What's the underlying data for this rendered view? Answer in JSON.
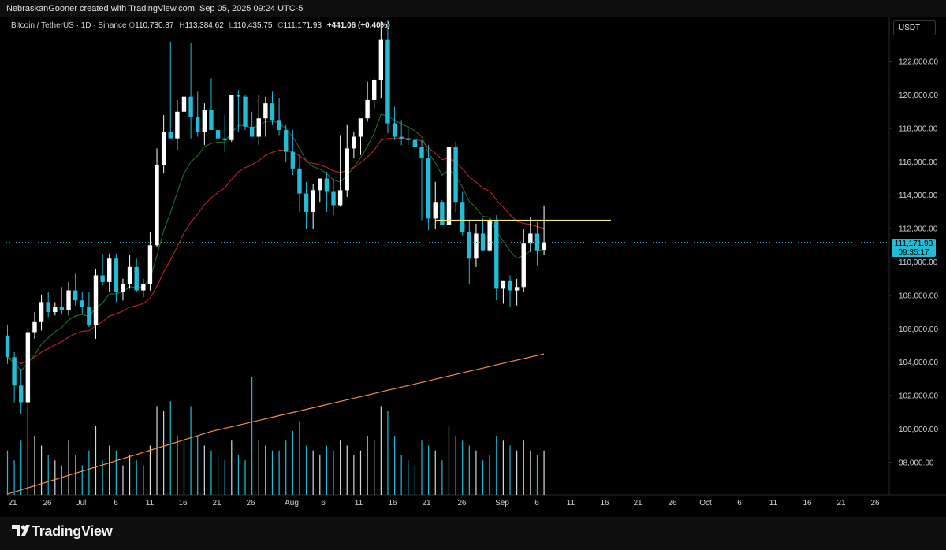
{
  "header": {
    "attribution": "NebraskanGooner created with TradingView.com, Sep 05, 2025 09:24 UTC-5"
  },
  "legend": {
    "symbol": "Bitcoin / TetherUS · 1D · Binance",
    "open_label": "O",
    "open": "110,730.87",
    "high_label": "H",
    "high": "113,384.62",
    "low_label": "L",
    "low": "110,435.75",
    "close_label": "C",
    "close": "111,171.93",
    "change": "+441.06 (+0.40%)"
  },
  "currency_button": "USDT",
  "price_tag": {
    "price": "111,171.93",
    "countdown": "09:35:17"
  },
  "branding": {
    "name": "TradingView"
  },
  "colors": {
    "up": "#ffffff",
    "down": "#22bcd6",
    "ema_fast": "#1f6e30",
    "ema_slow": "#b8262a",
    "ma_long": "#f28c4c",
    "hline": "#f5e28a"
  },
  "chart_data": {
    "type": "candlestick",
    "x_start": "2025-06-20",
    "x_end": "2025-09-05",
    "ylim": [
      96000,
      124000
    ],
    "yticks": [
      "122,000.00",
      "120,000.00",
      "118,000.00",
      "116,000.00",
      "114,000.00",
      "112,000.00",
      "110,000.00",
      "108,000.00",
      "106,000.00",
      "104,000.00",
      "102,000.00",
      "100,000.00",
      "98,000.00"
    ],
    "xticks": [
      "21",
      "26",
      "Jul",
      "6",
      "11",
      "16",
      "21",
      "26",
      "Aug",
      "6",
      "11",
      "16",
      "21",
      "26",
      "Sep",
      "6",
      "11",
      "16",
      "21",
      "26",
      "Oct",
      "6",
      "11",
      "16",
      "21",
      "26"
    ],
    "candles": [
      [
        105600,
        106200,
        103900,
        104300
      ],
      [
        104300,
        104600,
        101600,
        102600
      ],
      [
        102600,
        103600,
        100900,
        101600
      ],
      [
        101600,
        106000,
        101300,
        105800
      ],
      [
        105800,
        107000,
        105400,
        106400
      ],
      [
        106400,
        108000,
        105900,
        107600
      ],
      [
        107600,
        108200,
        106700,
        107000
      ],
      [
        107000,
        107600,
        106800,
        107300
      ],
      [
        107300,
        108500,
        106900,
        107100
      ],
      [
        107100,
        108800,
        106800,
        108300
      ],
      [
        108300,
        109300,
        107400,
        107700
      ],
      [
        107700,
        108200,
        106900,
        107300
      ],
      [
        107300,
        108200,
        106100,
        106200
      ],
      [
        106200,
        109600,
        105400,
        109200
      ],
      [
        109200,
        110500,
        108600,
        108800
      ],
      [
        108800,
        110500,
        108200,
        110200
      ],
      [
        110200,
        110500,
        107600,
        108200
      ],
      [
        108200,
        109000,
        107700,
        108700
      ],
      [
        108700,
        110400,
        108400,
        109700
      ],
      [
        109700,
        110200,
        108200,
        108300
      ],
      [
        108300,
        109000,
        107900,
        108700
      ],
      [
        108700,
        111800,
        108300,
        111000
      ],
      [
        111000,
        116800,
        110900,
        115800
      ],
      [
        115800,
        118800,
        115300,
        117800
      ],
      [
        117800,
        123200,
        117500,
        117400
      ],
      [
        117400,
        119700,
        116700,
        119000
      ],
      [
        119000,
        120200,
        117800,
        119900
      ],
      [
        119900,
        123100,
        117400,
        118700
      ],
      [
        118700,
        120200,
        117500,
        117800
      ],
      [
        117800,
        119500,
        117000,
        119100
      ],
      [
        119100,
        121000,
        118300,
        117900
      ],
      [
        117900,
        119600,
        117400,
        117400
      ],
      [
        117400,
        118800,
        116600,
        117300
      ],
      [
        117300,
        120000,
        117200,
        120000
      ],
      [
        120000,
        120300,
        117800,
        119900
      ],
      [
        119900,
        120000,
        117900,
        118100
      ],
      [
        118100,
        119000,
        117600,
        117500
      ],
      [
        117500,
        120000,
        117000,
        118600
      ],
      [
        118600,
        119900,
        117500,
        119500
      ],
      [
        119500,
        120200,
        118200,
        118500
      ],
      [
        118500,
        119800,
        117600,
        117900
      ],
      [
        117900,
        118200,
        116000,
        116600
      ],
      [
        116600,
        117900,
        115200,
        115600
      ],
      [
        115600,
        116400,
        113000,
        114100
      ],
      [
        114100,
        114800,
        112000,
        113000
      ],
      [
        113000,
        114700,
        112000,
        114300
      ],
      [
        114300,
        114500,
        113600,
        115000
      ],
      [
        115000,
        115400,
        113000,
        114200
      ],
      [
        114200,
        115000,
        112800,
        113400
      ],
      [
        113400,
        117600,
        113300,
        114300
      ],
      [
        114300,
        118200,
        113900,
        116800
      ],
      [
        116800,
        117800,
        116200,
        117500
      ],
      [
        117500,
        118500,
        116400,
        118600
      ],
      [
        118600,
        120800,
        118400,
        119700
      ],
      [
        119700,
        121000,
        119200,
        120900
      ],
      [
        120900,
        124400,
        119800,
        123300
      ],
      [
        123300,
        124500,
        117700,
        118300
      ],
      [
        118300,
        119300,
        117300,
        117500
      ],
      [
        117500,
        118500,
        117000,
        117400
      ],
      [
        117400,
        118100,
        117000,
        117300
      ],
      [
        117300,
        117400,
        116300,
        116900
      ],
      [
        116900,
        117300,
        112500,
        116200
      ],
      [
        116200,
        117000,
        111900,
        112600
      ],
      [
        112600,
        114800,
        112000,
        113600
      ],
      [
        113600,
        113700,
        112800,
        112200
      ],
      [
        112200,
        117300,
        111800,
        116900
      ],
      [
        116900,
        117200,
        113000,
        113600
      ],
      [
        113600,
        114200,
        111600,
        111800
      ],
      [
        111800,
        112500,
        108700,
        110200
      ],
      [
        110200,
        112300,
        109700,
        111700
      ],
      [
        111700,
        112600,
        110900,
        110700
      ],
      [
        110700,
        112600,
        110600,
        112500
      ],
      [
        112500,
        112800,
        107700,
        108400
      ],
      [
        108400,
        108900,
        107500,
        108900
      ],
      [
        108900,
        109200,
        107300,
        108300
      ],
      [
        108300,
        109000,
        107400,
        108500
      ],
      [
        108500,
        112000,
        108200,
        111100
      ],
      [
        111100,
        112700,
        110600,
        111700
      ],
      [
        111700,
        112400,
        109800,
        110700
      ],
      [
        110730,
        113385,
        110436,
        111172
      ]
    ]
  }
}
